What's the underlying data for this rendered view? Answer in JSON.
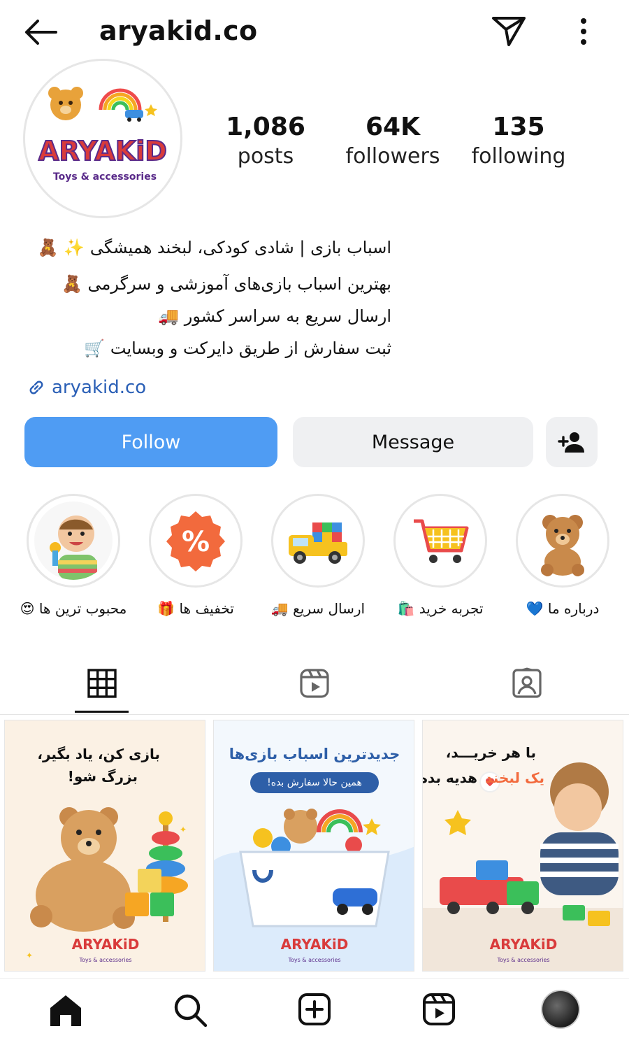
{
  "header": {
    "username": "aryakid.co"
  },
  "profile": {
    "logo_text": "ARYAKiD",
    "logo_tagline": "Toys & accessories",
    "stats": [
      {
        "value": "1,086",
        "label": "posts"
      },
      {
        "value": "64K",
        "label": "followers"
      },
      {
        "value": "135",
        "label": "following"
      }
    ],
    "bio": [
      "اسباب بازی | شادی کودکی، لبخند همیشگی ✨ 🧸",
      "بهترین اسباب بازی‌های آموزشی و سرگرمی 🧸",
      "ارسال سریع به سراسر کشور 🚚",
      "ثبت سفارش از طریق دایرکت و وبسایت 🛒"
    ],
    "link": "aryakid.co"
  },
  "actions": {
    "follow": "Follow",
    "message": "Message"
  },
  "highlights": [
    {
      "label": "محبوب ترین ها 😍",
      "icon": "baby-photo"
    },
    {
      "label": "تخفیف ها 🎁",
      "icon": "discount-badge"
    },
    {
      "label": "ارسال سریع 🚚",
      "icon": "toy-truck"
    },
    {
      "label": "تجربه خرید 🛍️",
      "icon": "shopping-cart"
    },
    {
      "label": "درباره ما 💙",
      "icon": "teddy-bear"
    }
  ],
  "posts": [
    {
      "line1": "بازی کن، یاد بگیر،",
      "line2": "بزرگ شو!",
      "brand": "ARYAKiD",
      "tagline": "Toys & accessories"
    },
    {
      "line1": "جدیدترین اسباب بازی‌ها",
      "pill": "همین حالا سفارش بده!",
      "brand": "ARYAKiD",
      "tagline": "Toys & accessories"
    },
    {
      "line1": "با هر خریـــد،",
      "line2a": "یک لبخند",
      "line2b": "هدیه بده",
      "brand": "ARYAKiD",
      "tagline": "Toys & accessories"
    }
  ],
  "colors": {
    "follow": "#4f9cf3",
    "button_gray": "#eff0f2",
    "link": "#2a5fb6",
    "accent_orange": "#f26a3d"
  }
}
